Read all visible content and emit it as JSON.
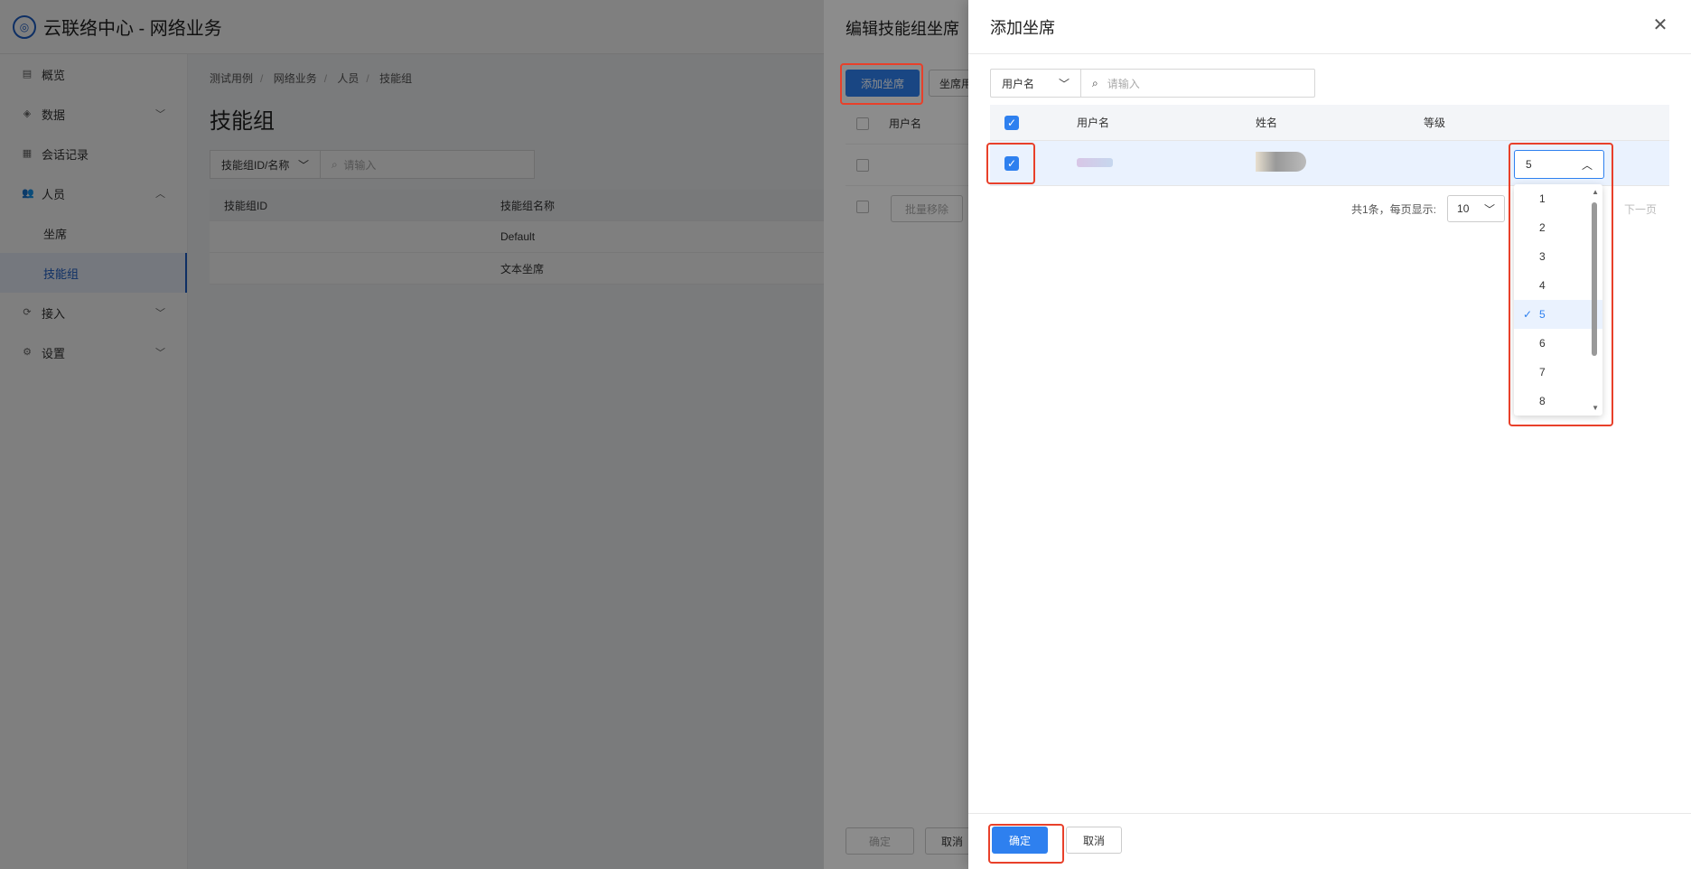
{
  "app": {
    "title": "云联络中心 - 网络业务"
  },
  "sidebar": {
    "items": [
      {
        "label": "概览"
      },
      {
        "label": "数据"
      },
      {
        "label": "会话记录"
      },
      {
        "label": "人员"
      },
      {
        "label": "坐席"
      },
      {
        "label": "技能组"
      },
      {
        "label": "接入"
      },
      {
        "label": "设置"
      }
    ]
  },
  "breadcrumb": [
    "测试用例",
    "网络业务",
    "人员",
    "技能组"
  ],
  "page": {
    "title": "技能组",
    "filter_select": "技能组ID/名称",
    "filter_placeholder": "请输入",
    "table": {
      "headers": [
        "技能组ID",
        "技能组名称"
      ],
      "rows": [
        {
          "name": "Default"
        },
        {
          "name": "文本坐席"
        }
      ]
    }
  },
  "drawer_edit": {
    "title": "编辑技能组坐席",
    "add_button": "添加坐席",
    "other_button": "坐席用",
    "col_username": "用户名",
    "batch_remove": "批量移除",
    "ok": "确定",
    "cancel": "取消"
  },
  "drawer_add": {
    "title": "添加坐席",
    "search_select": "用户名",
    "search_placeholder": "请输入",
    "headers": {
      "username": "用户名",
      "name": "姓名",
      "level": "等级"
    },
    "row_level": "5",
    "pagination": {
      "total": "共1条，每页显示:",
      "page_size": "10",
      "next": "下一页"
    },
    "level_options": [
      "1",
      "2",
      "3",
      "4",
      "5",
      "6",
      "7",
      "8"
    ],
    "selected_level": "5",
    "ok": "确定",
    "cancel": "取消"
  },
  "colors": {
    "primary": "#2e80ef",
    "highlight": "#e8402a"
  }
}
